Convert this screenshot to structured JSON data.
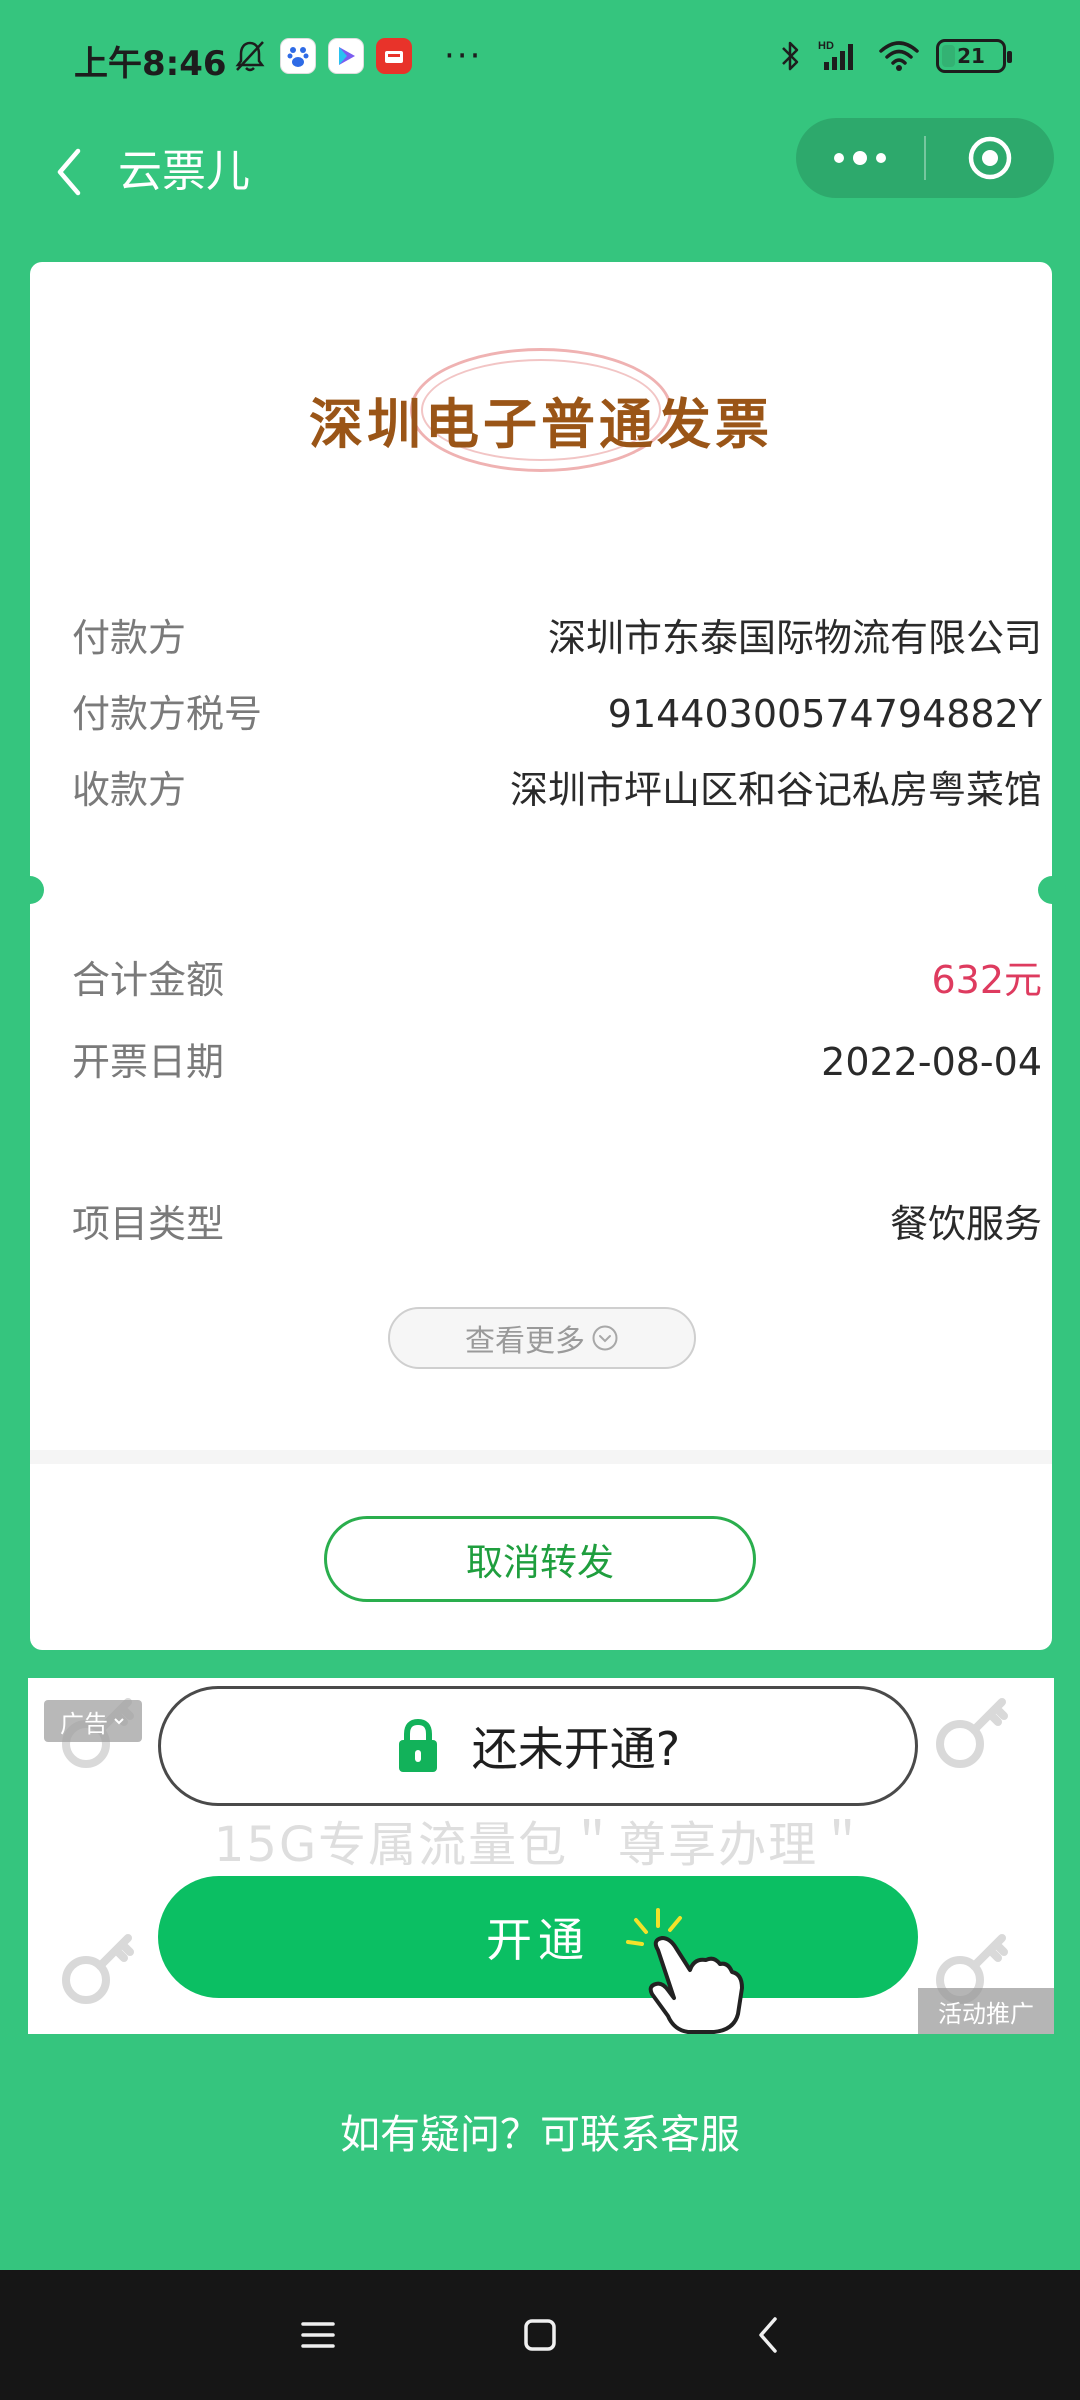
{
  "status_bar": {
    "time": "上午8:46",
    "battery": "21"
  },
  "nav": {
    "title": "云票儿"
  },
  "invoice": {
    "title": "深圳电子普通发票",
    "payer_label": "付款方",
    "payer_value": "深圳市东泰国际物流有限公司",
    "tax_id_label": "付款方税号",
    "tax_id_value": "91440300574794882Y",
    "payee_label": "收款方",
    "payee_value": "深圳市坪山区和谷记私房粤菜馆",
    "amount_label": "合计金额",
    "amount_value": "632元",
    "date_label": "开票日期",
    "date_value": "2022-08-04",
    "category_label": "项目类型",
    "category_value": "餐饮服务",
    "more_label": "查看更多",
    "cancel_label": "取消转发"
  },
  "ad": {
    "badge": "广告",
    "title": "还未开通?",
    "subtitle": "15G专属流量包＂尊享办理＂",
    "open_label": "开通",
    "promo_tag": "活动推广"
  },
  "footer": {
    "contact": "如有疑问？可联系客服"
  },
  "colors": {
    "background": "#35c57e",
    "title_brown": "#9a5517",
    "amount_red": "#de3b5f",
    "cta_green": "#0bbf63"
  }
}
